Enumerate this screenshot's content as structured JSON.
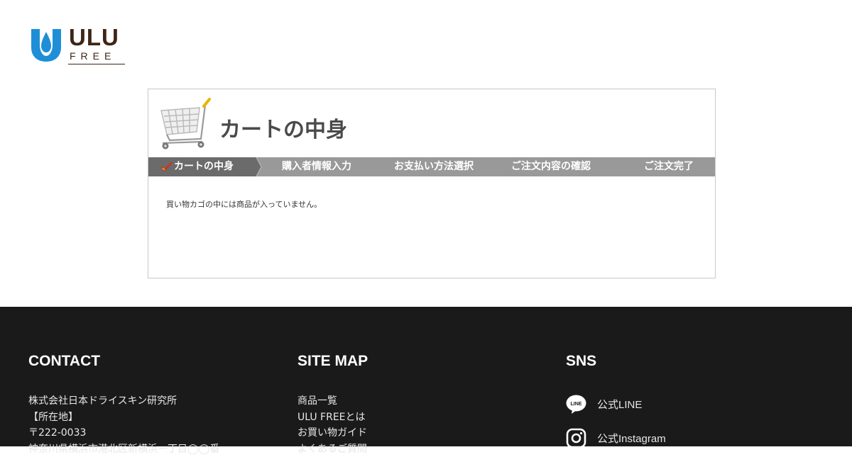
{
  "brand": {
    "name": "ULU",
    "sub": "FREE",
    "colors": {
      "drop": "#1e8fd6",
      "text": "#3e2516"
    }
  },
  "cart": {
    "title": "カートの中身",
    "steps": [
      {
        "label": "カートの中身",
        "active": true
      },
      {
        "label": "購入者情報入力",
        "active": false
      },
      {
        "label": "お支払い方法選択",
        "active": false
      },
      {
        "label": "ご注文内容の確認",
        "active": false
      },
      {
        "label": "ご注文完了",
        "active": false
      }
    ],
    "empty_message": "買い物カゴの中には商品が入っていません。",
    "colors": {
      "step_bar": "#999999",
      "step_active": "#6b6b6b",
      "check": "#c0392b"
    }
  },
  "footer": {
    "contact": {
      "heading": "CONTACT",
      "lines": [
        "株式会社日本ドライスキン研究所",
        "【所在地】",
        "〒222-0033",
        "神奈川県横浜市港北区新横浜一丁目◯◯番"
      ]
    },
    "sitemap": {
      "heading": "SITE MAP",
      "links": [
        "商品一覧",
        "ULU FREEとは",
        "お買い物ガイド",
        "よくあるご質問"
      ]
    },
    "sns": {
      "heading": "SNS",
      "links": [
        {
          "label": "公式LINE",
          "icon": "line-icon"
        },
        {
          "label": "公式Instagram",
          "icon": "instagram-icon"
        }
      ]
    },
    "colors": {
      "background": "#1a1a1a"
    }
  }
}
